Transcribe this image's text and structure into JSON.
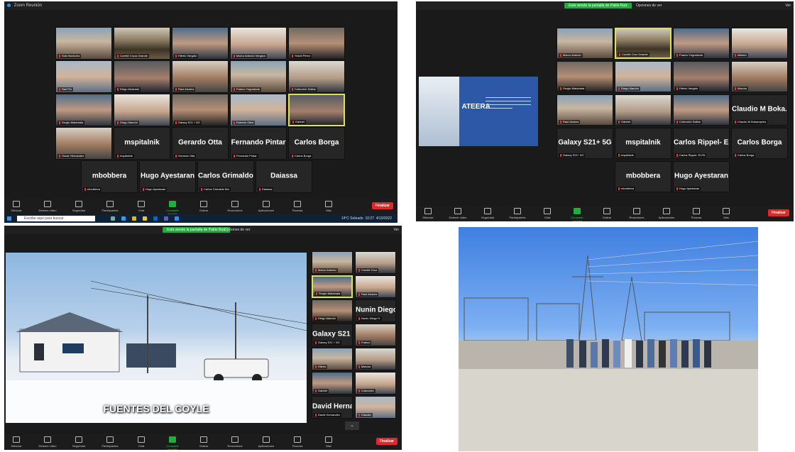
{
  "panel1": {
    "window_title": "Zoom Reunión",
    "tiles": [
      {
        "kind": "video",
        "label": "Solo Nocturno"
      },
      {
        "kind": "video",
        "label": "Comité Cruza Grande"
      },
      {
        "kind": "video",
        "label": "Hilerio Vergalo"
      },
      {
        "kind": "video",
        "label": "Marco Antonio Vergara"
      },
      {
        "kind": "video",
        "label": "Yoseli Pérez"
      },
      {
        "kind": "video",
        "label": "Sari Flo"
      },
      {
        "kind": "video",
        "label": "Diego Alvarado"
      },
      {
        "kind": "video",
        "label": "Raul Alvarez"
      },
      {
        "kind": "video",
        "label": "Franco Yugoslavia"
      },
      {
        "kind": "video",
        "label": "Colección Saltos"
      },
      {
        "kind": "video",
        "label": "Sergio Matamala"
      },
      {
        "kind": "video",
        "label": "Diego Alarcón"
      },
      {
        "kind": "video",
        "label": "Galaxy S21 + 5G"
      },
      {
        "kind": "video",
        "label": "Roberto Oltra"
      },
      {
        "kind": "video",
        "label": "Gabriel"
      },
      {
        "kind": "video",
        "label": "Oscar Hernandez"
      },
      {
        "kind": "name",
        "name": "mspitalnik",
        "label": "mspitalnik"
      },
      {
        "kind": "name",
        "name": "Gerardo Otta",
        "label": "Gerardo Otta"
      },
      {
        "kind": "name",
        "name": "Fernando Pintar",
        "label": "Fernando Pintar"
      },
      {
        "kind": "name",
        "name": "Carlos Borga",
        "label": "Carlos Borga"
      },
      {
        "kind": "name",
        "name": "mbobbera",
        "label": "mbobbera"
      },
      {
        "kind": "name",
        "name": "Hugo Ayestaran",
        "label": "Hugo Ayestaran"
      },
      {
        "kind": "name",
        "name": "Carlos  Grimaldo...",
        "label": "Carlos Grimaldo Bio"
      },
      {
        "kind": "name",
        "name": "Daiassa",
        "label": "Daiassa"
      }
    ],
    "toolbar": [
      {
        "label": "Silenciar"
      },
      {
        "label": "Detener video"
      },
      {
        "label": "Seguridad"
      },
      {
        "label": "Participantes"
      },
      {
        "label": "Chat"
      },
      {
        "label": "Compartir pantalla"
      },
      {
        "label": "Grabar"
      },
      {
        "label": "Reacciones"
      },
      {
        "label": "Aplicaciones"
      },
      {
        "label": "Pizarras"
      },
      {
        "label": "Más"
      }
    ],
    "end_label": "Finalizar",
    "taskbar": {
      "search_placeholder": "Escribe aquí para buscar",
      "weather": "14°C Soleado",
      "time": "10:27",
      "date": "4/10/2022"
    }
  },
  "panel2": {
    "share_pill": "Está viendo la pantalla de Pablo Ruiz",
    "view_options": "Opciones de ver",
    "view_button": "Ver",
    "slide": {
      "brand": "ATEERA"
    },
    "tiles": [
      {
        "kind": "video",
        "label": "Marco Antonio"
      },
      {
        "kind": "video",
        "label": "Comité Cruz Grande"
      },
      {
        "kind": "video",
        "label": "Franco Yugoslavia"
      },
      {
        "kind": "video",
        "label": "Alberto"
      },
      {
        "kind": "video",
        "label": "Sergio Matamala"
      },
      {
        "kind": "video",
        "label": "Diego Alarcón"
      },
      {
        "kind": "video",
        "label": "Hilerio Vergalo"
      },
      {
        "kind": "video",
        "label": "Marcos"
      },
      {
        "kind": "video",
        "label": "Raul Alvarez"
      },
      {
        "kind": "video",
        "label": "Gabriel"
      },
      {
        "kind": "video",
        "label": "Colección Saltos"
      },
      {
        "kind": "name",
        "name": "Claudio M Boka...",
        "label": "Claudio M Bokamperis"
      },
      {
        "kind": "name",
        "name": "Galaxy S21+ 5G",
        "label": "Galaxy S21+ 5G"
      },
      {
        "kind": "name",
        "name": "mspitalnik",
        "label": "mspitalnik"
      },
      {
        "kind": "name",
        "name": "Carlos Rippel- E...",
        "label": "Carlos Rippel- ELPA"
      },
      {
        "kind": "name",
        "name": "Carlos Borga",
        "label": "Carlos Borga"
      },
      {
        "kind": "name",
        "name": "mbobbera",
        "label": "mbobbera"
      },
      {
        "kind": "name",
        "name": "Hugo Ayestaran",
        "label": "Hugo Ayestaran"
      }
    ],
    "toolbar": [
      {
        "label": "Silenciar"
      },
      {
        "label": "Detener video"
      },
      {
        "label": "Seguridad"
      },
      {
        "label": "Participantes"
      },
      {
        "label": "Chat"
      },
      {
        "label": "Compartir pantalla"
      },
      {
        "label": "Grabar"
      },
      {
        "label": "Reacciones"
      },
      {
        "label": "Aplicaciones"
      },
      {
        "label": "Pizarras"
      },
      {
        "label": "Más"
      }
    ],
    "end_label": "Finalizar"
  },
  "panel3": {
    "share_pill": "Está viendo la pantalla de Pablo Ruiz",
    "view_options": "Opciones de ver",
    "view_button": "Ver",
    "caption": "FUENTES DEL COYLE",
    "tiles": [
      {
        "kind": "video",
        "label": "Marco Antonio"
      },
      {
        "kind": "video",
        "label": "Comité Cruz"
      },
      {
        "kind": "video",
        "label": "Sergio Matamala"
      },
      {
        "kind": "video",
        "label": "Raul Alvarez"
      },
      {
        "kind": "video",
        "label": "Diego Alarcón"
      },
      {
        "kind": "name",
        "name": "Nunin Diego H.",
        "label": "Nunin Diego H."
      },
      {
        "kind": "name",
        "name": "Galaxy S21 + 5G",
        "label": "Galaxy S21 + 5G"
      },
      {
        "kind": "video",
        "label": "Franco"
      },
      {
        "kind": "video",
        "label": "Hilerio"
      },
      {
        "kind": "video",
        "label": "Marcos"
      },
      {
        "kind": "video",
        "label": "Gabriel"
      },
      {
        "kind": "video",
        "label": "Colección"
      },
      {
        "kind": "name",
        "name": "David Hernandez",
        "label": "David Hernandez"
      },
      {
        "kind": "video",
        "label": "Claudio"
      }
    ],
    "toolbar": [
      {
        "label": "Silenciar"
      },
      {
        "label": "Detener video"
      },
      {
        "label": "Seguridad"
      },
      {
        "label": "Participantes"
      },
      {
        "label": "Chat"
      },
      {
        "label": "Compartir pantalla"
      },
      {
        "label": "Grabar"
      },
      {
        "label": "Reacciones"
      },
      {
        "label": "Aplicaciones"
      },
      {
        "label": "Pizarras"
      },
      {
        "label": "Más"
      }
    ],
    "end_label": "Finalizar"
  },
  "colors": {
    "zoom_green": "#19b33c",
    "end_red": "#e02828",
    "active_border": "#d8e35a"
  }
}
